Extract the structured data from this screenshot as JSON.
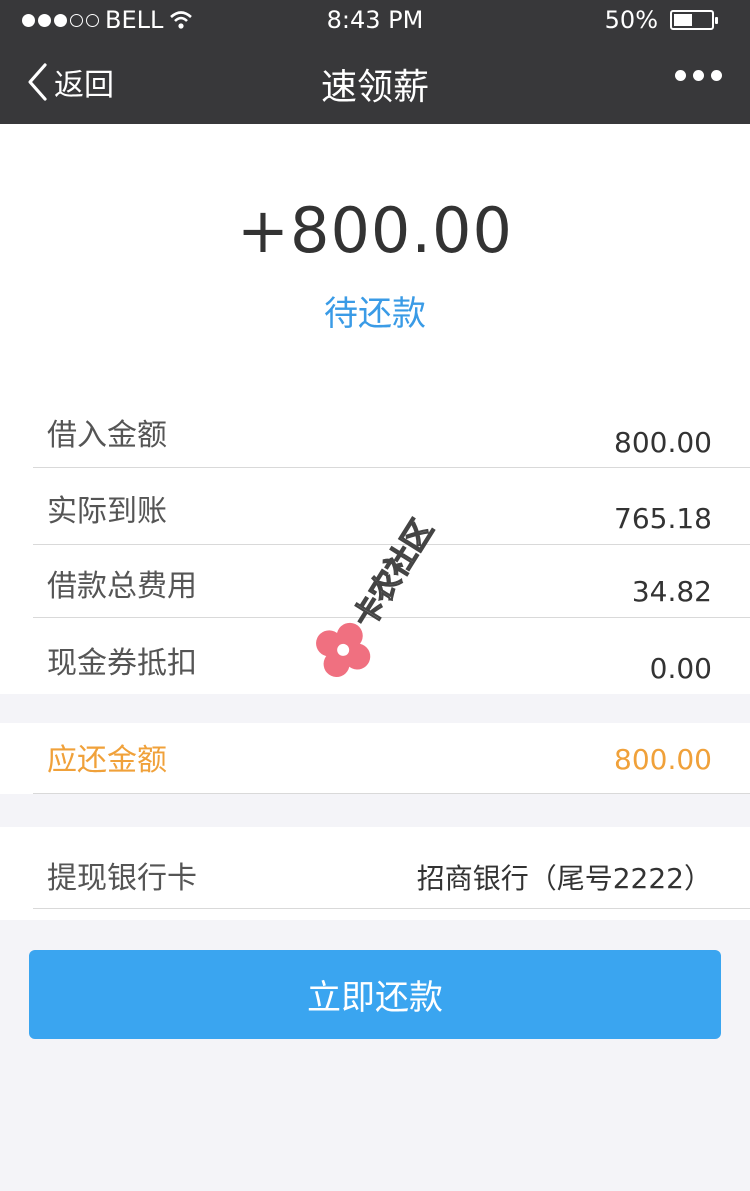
{
  "status_bar": {
    "carrier": "BELL",
    "time": "8:43 PM",
    "battery": "50%",
    "battery_level": 0.5,
    "signal_bars_filled": 3,
    "signal_bars_total": 5
  },
  "nav": {
    "back_label": "返回",
    "title": "速领薪"
  },
  "summary": {
    "amount": "+800.00",
    "status": "待还款"
  },
  "details": [
    {
      "label": "借入金额",
      "value": "800.00"
    },
    {
      "label": "实际到账",
      "value": "765.18"
    },
    {
      "label": "借款总费用",
      "value": "34.82"
    },
    {
      "label": "现金券抵扣",
      "value": "0.00"
    }
  ],
  "due": {
    "label": "应还金额",
    "value": "800.00"
  },
  "bank": {
    "label": "提现银行卡",
    "value": "招商银行（尾号2222）"
  },
  "action": {
    "label": "立即还款"
  },
  "watermark": {
    "text": "卡农社区"
  },
  "colors": {
    "nav_bg": "#38383a",
    "accent_blue": "#3a9be6",
    "button_blue": "#3aa5f0",
    "due_orange": "#f0a13a",
    "page_bg": "#f4f4f8"
  }
}
